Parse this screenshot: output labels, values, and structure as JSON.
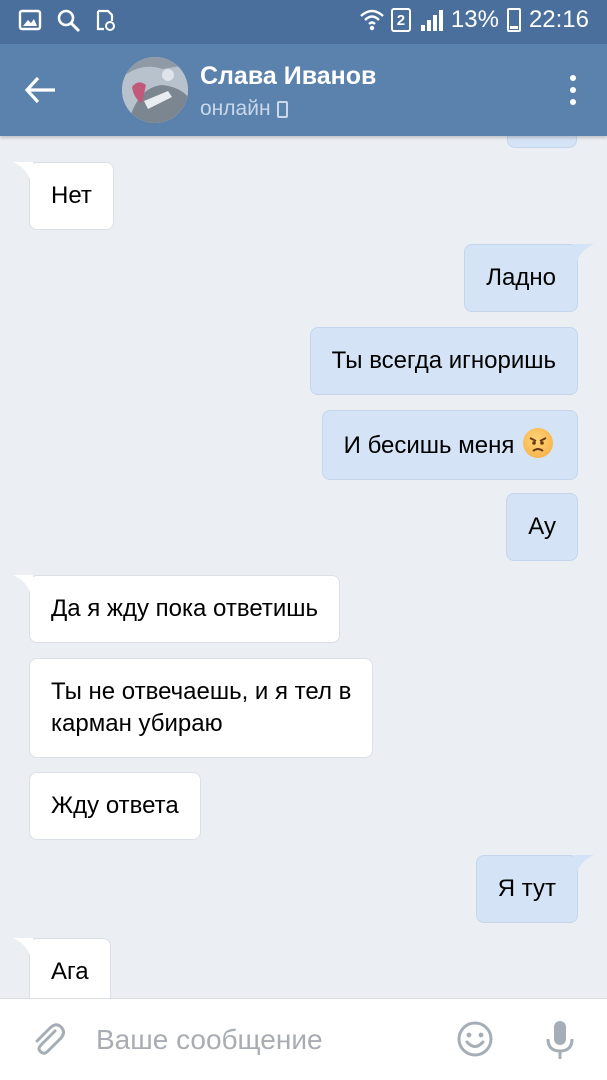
{
  "status_bar": {
    "battery_percent": "13%",
    "time": "22:16",
    "sim_number": "2",
    "icons": [
      "gallery-icon",
      "search-icon",
      "cast-icon",
      "wifi-icon",
      "signal-icon",
      "battery-icon"
    ]
  },
  "header": {
    "contact_name": "Слава Иванов",
    "status": "онлайн",
    "icons": [
      "back-arrow-icon",
      "avatar",
      "mobile-phone-icon",
      "more-vertical-icon"
    ]
  },
  "messages": [
    {
      "direction": "in",
      "text": "Нет"
    },
    {
      "direction": "out",
      "text": "Ладно"
    },
    {
      "direction": "out",
      "text": "Ты всегда игноришь"
    },
    {
      "direction": "out",
      "text": "И бесишь меня",
      "emoji": "angry-face-icon"
    },
    {
      "direction": "out",
      "text": "Ау"
    },
    {
      "direction": "in",
      "text": "Да я жду пока ответишь"
    },
    {
      "direction": "in",
      "text": "Ты не отвечаешь, и я тел в\nкарман убираю"
    },
    {
      "direction": "in",
      "text": "Жду ответа"
    },
    {
      "direction": "out",
      "text": "Я тут"
    },
    {
      "direction": "in",
      "text": "Ага"
    }
  ],
  "input": {
    "placeholder": "Ваше сообщение",
    "value": "",
    "icons": [
      "paperclip-icon",
      "emoji-icon",
      "microphone-icon"
    ]
  },
  "colors": {
    "status_bar_bg": "#4a6f9c",
    "header_bg": "#5b81ad",
    "chat_bg": "#ebeef3",
    "incoming_bubble": "#ffffff",
    "outgoing_bubble": "#d4e3f5"
  }
}
